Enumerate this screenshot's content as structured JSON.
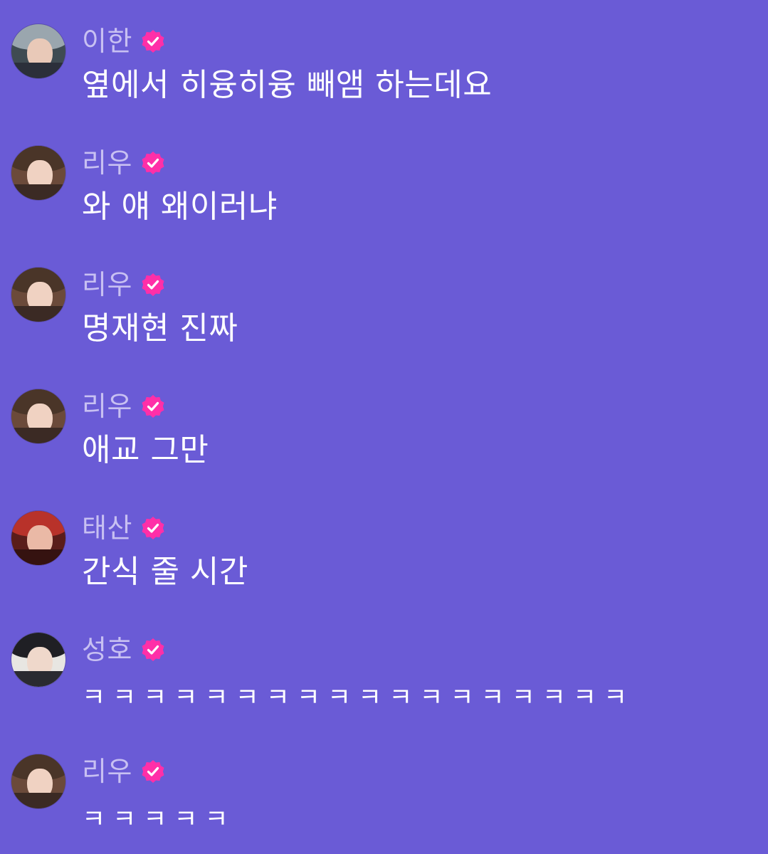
{
  "colors": {
    "background": "#6a5bd6",
    "name": "#c8c0f2",
    "message": "#ffffff",
    "badge": "#ff2fa8"
  },
  "messages": [
    {
      "name": "이한",
      "text": "옆에서 히융히융 빼앰 하는데요",
      "avatar": {
        "hair": "#9aa6ae",
        "face": "#e9c9b8",
        "bg": "#3f4b52",
        "shade": "#2b2f3a"
      }
    },
    {
      "name": "리우",
      "text": "와 얘 왜이러냐",
      "avatar": {
        "hair": "#4a3528",
        "face": "#f0d2c2",
        "bg": "#6b4a3a",
        "shade": "#3b2a24"
      }
    },
    {
      "name": "리우",
      "text": "명재현 진짜",
      "avatar": {
        "hair": "#4a3528",
        "face": "#f0d2c2",
        "bg": "#6b4a3a",
        "shade": "#3b2a24"
      }
    },
    {
      "name": "리우",
      "text": "애교 그만",
      "avatar": {
        "hair": "#4a3528",
        "face": "#f0d2c2",
        "bg": "#6b4a3a",
        "shade": "#3b2a24"
      }
    },
    {
      "name": "태산",
      "text": "간식 줄 시간",
      "avatar": {
        "hair": "#b8322a",
        "face": "#eab9a6",
        "bg": "#5a1d1a",
        "shade": "#351210"
      }
    },
    {
      "name": "성호",
      "text": "ㅋㅋㅋㅋㅋㅋㅋㅋㅋㅋㅋㅋㅋㅋㅋㅋㅋㅋ",
      "avatar": {
        "hair": "#1f1f24",
        "face": "#efd8cb",
        "bg": "#e8e6e2",
        "shade": "#2a2a30"
      }
    },
    {
      "name": "리우",
      "text": "ㅋㅋㅋㅋㅋ",
      "avatar": {
        "hair": "#4a3528",
        "face": "#f0d2c2",
        "bg": "#6b4a3a",
        "shade": "#3b2a24"
      }
    }
  ],
  "icons": {
    "badge": "verified-check-badge"
  }
}
